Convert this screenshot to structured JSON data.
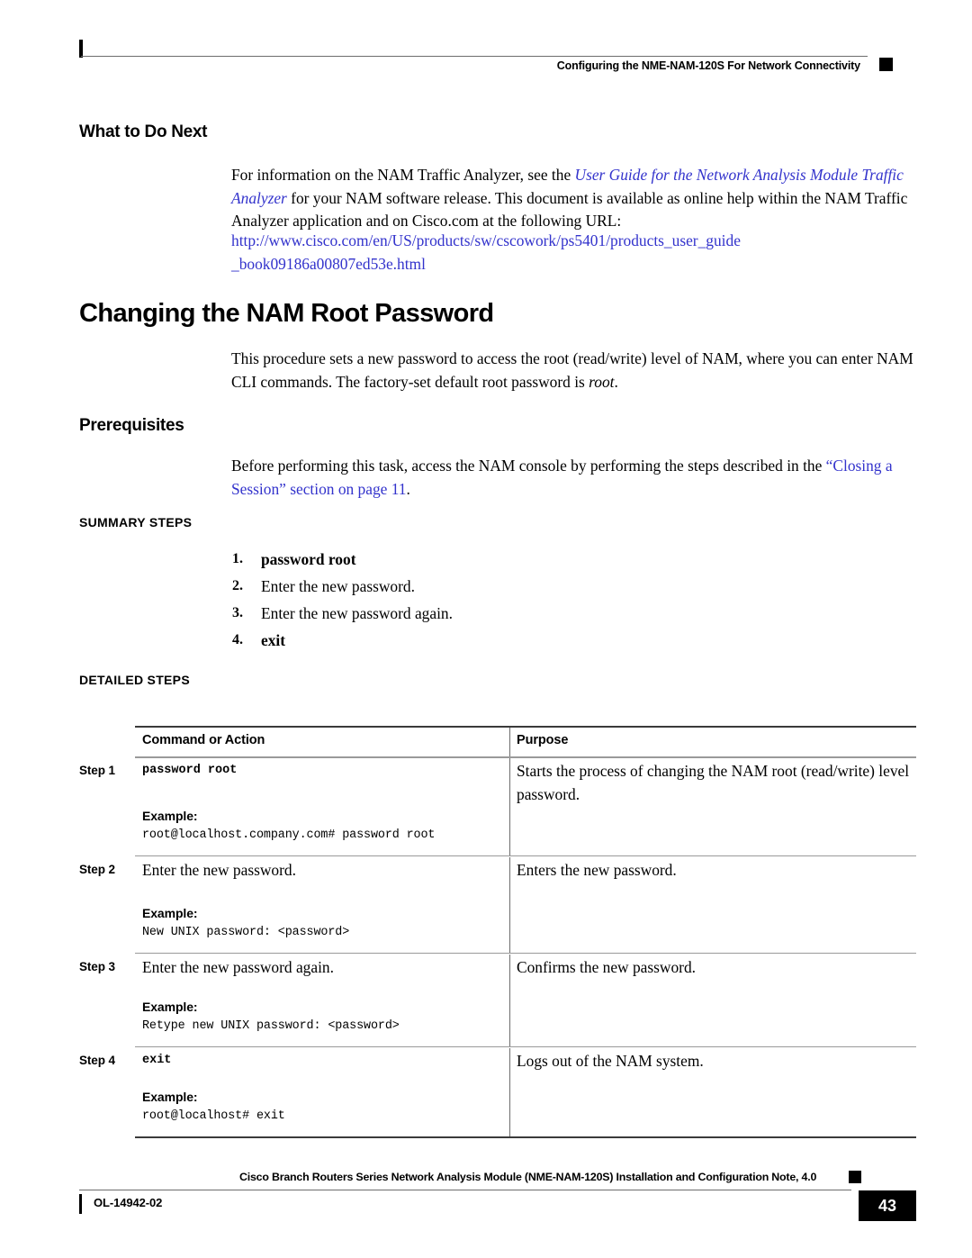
{
  "header": {
    "title": "Configuring the NME-NAM-120S For Network Connectivity"
  },
  "sections": {
    "what_to_do_next": {
      "heading": "What to Do Next",
      "para_1_pre": "For information on the NAM Traffic Analyzer, see the ",
      "para_1_link": "User Guide for the Network Analysis Module Traffic Analyzer",
      "para_1_post": " for your NAM software release. This document is available as online help within the NAM Traffic Analyzer application and on Cisco.com at the following URL:",
      "url_line_1": "http://www.cisco.com/en/US/products/sw/cscowork/ps5401/products_user_guide",
      "url_line_2": "_book09186a00807ed53e.html"
    },
    "changing_root_password": {
      "heading": "Changing the NAM Root Password",
      "para_pre": "This procedure sets a new password to access the root (read/write) level of NAM, where you can enter NAM CLI commands. The factory-set default root password is ",
      "para_italic": "root",
      "para_post": "."
    },
    "prerequisites": {
      "heading": "Prerequisites",
      "para_pre": "Before performing this task, access the NAM console by performing the steps described in the ",
      "para_link": "“Closing a Session” section on page 11",
      "para_post": "."
    },
    "summary_steps": {
      "heading": "SUMMARY STEPS",
      "items": [
        {
          "num": "1.",
          "text": "password root",
          "bold": true
        },
        {
          "num": "2.",
          "text": "Enter the new password.",
          "bold": false
        },
        {
          "num": "3.",
          "text": "Enter the new password again.",
          "bold": false
        },
        {
          "num": "4.",
          "text": "exit",
          "bold": true
        }
      ]
    },
    "detailed_steps": {
      "heading": "DETAILED STEPS",
      "columns": {
        "command": "Command or Action",
        "purpose": "Purpose"
      },
      "example_label": "Example:",
      "rows": [
        {
          "step_label": "Step 1",
          "command": "password root",
          "command_is_code": true,
          "purpose": "Starts the process of changing the NAM root (read/write) level password.",
          "example": "root@localhost.company.com# password root"
        },
        {
          "step_label": "Step 2",
          "command": "Enter the new password.",
          "command_is_code": false,
          "purpose": "Enters the new password.",
          "example": "New UNIX password: <password>"
        },
        {
          "step_label": "Step 3",
          "command": "Enter the new password again.",
          "command_is_code": false,
          "purpose": "Confirms the new password.",
          "example": "Retype new UNIX password: <password>"
        },
        {
          "step_label": "Step 4",
          "command": "exit",
          "command_is_code": true,
          "purpose": "Logs out of the NAM system.",
          "example": "root@localhost# exit"
        }
      ]
    }
  },
  "footer": {
    "doc_title": "Cisco Branch Routers Series Network Analysis Module (NME-NAM-120S) Installation and Configuration Note, 4.0",
    "doc_id": "OL-14942-02",
    "page_number": "43"
  },
  "colors": {
    "link": "#3333cc",
    "text": "#000000",
    "rule": "#6d6d6d"
  }
}
